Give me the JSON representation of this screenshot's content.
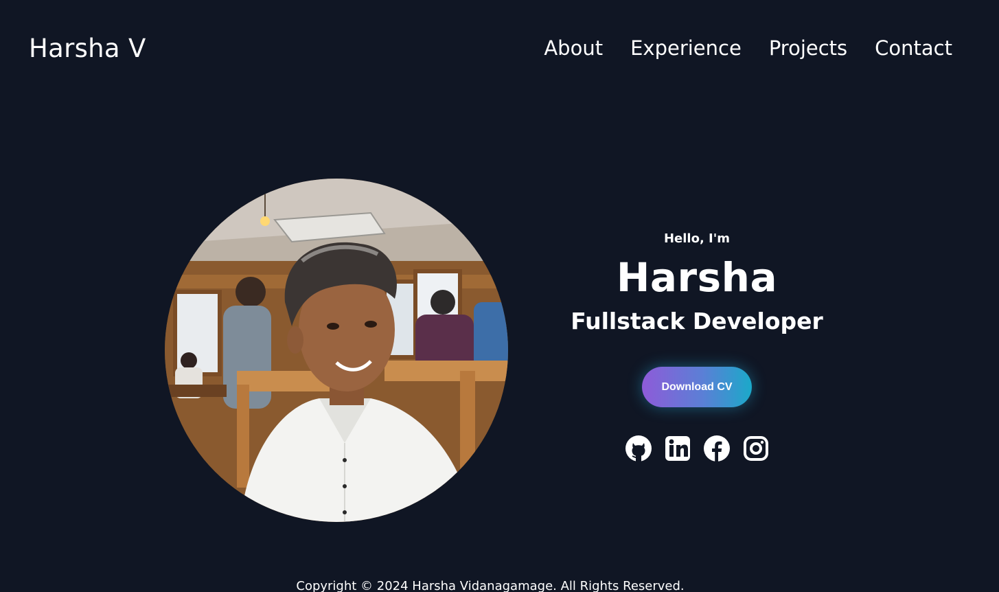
{
  "header": {
    "logo": "Harsha V",
    "nav": [
      {
        "label": "About"
      },
      {
        "label": "Experience"
      },
      {
        "label": "Projects"
      },
      {
        "label": "Contact"
      }
    ]
  },
  "hero": {
    "greeting": "Hello, I'm",
    "name": "Harsha",
    "role": "Fullstack Developer",
    "cv_button": "Download CV",
    "socials": [
      {
        "icon": "github-icon"
      },
      {
        "icon": "linkedin-icon"
      },
      {
        "icon": "facebook-icon"
      },
      {
        "icon": "instagram-icon"
      }
    ]
  },
  "footer": {
    "copyright": "Copyright © 2024 Harsha Vidanagamage. All Rights Reserved."
  },
  "colors": {
    "background": "#101624",
    "text": "#ffffff",
    "button_gradient_start": "#8e5bd8",
    "button_gradient_end": "#1ba9c9"
  }
}
